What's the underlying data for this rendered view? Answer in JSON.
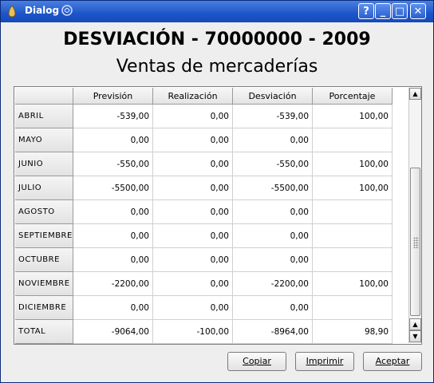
{
  "window": {
    "title": "Dialog",
    "help_glyph": "?",
    "minimize_glyph": "_",
    "maximize_glyph": "□",
    "close_glyph": "✕"
  },
  "heading": {
    "line1": "DESVIACIÓN - 70000000 - 2009",
    "line2": "Ventas de mercaderías"
  },
  "table": {
    "headers": [
      "Previsión",
      "Realización",
      "Desviación",
      "Porcentaje"
    ],
    "rows": [
      {
        "label": "ABRIL",
        "cells": [
          "-539,00",
          "0,00",
          "-539,00",
          "100,00"
        ]
      },
      {
        "label": "MAYO",
        "cells": [
          "0,00",
          "0,00",
          "0,00",
          ""
        ]
      },
      {
        "label": "JUNIO",
        "cells": [
          "-550,00",
          "0,00",
          "-550,00",
          "100,00"
        ]
      },
      {
        "label": "JULIO",
        "cells": [
          "-5500,00",
          "0,00",
          "-5500,00",
          "100,00"
        ]
      },
      {
        "label": "AGOSTO",
        "cells": [
          "0,00",
          "0,00",
          "0,00",
          ""
        ]
      },
      {
        "label": "SEPTIEMBRE",
        "cells": [
          "0,00",
          "0,00",
          "0,00",
          ""
        ]
      },
      {
        "label": "OCTUBRE",
        "cells": [
          "0,00",
          "0,00",
          "0,00",
          ""
        ]
      },
      {
        "label": "NOVIEMBRE",
        "cells": [
          "-2200,00",
          "0,00",
          "-2200,00",
          "100,00"
        ]
      },
      {
        "label": "DICIEMBRE",
        "cells": [
          "0,00",
          "0,00",
          "0,00",
          ""
        ]
      },
      {
        "label": "TOTAL",
        "cells": [
          "-9064,00",
          "-100,00",
          "-8964,00",
          "98,90"
        ]
      }
    ]
  },
  "scrollbar": {
    "up_glyph": "▲",
    "down_glyph": "▼"
  },
  "buttons": {
    "copy": "Copiar",
    "print": "Imprimir",
    "accept": "Aceptar"
  },
  "colors": {
    "titlebar": "#1d55c9",
    "dialog_bg": "#eeeeee"
  }
}
